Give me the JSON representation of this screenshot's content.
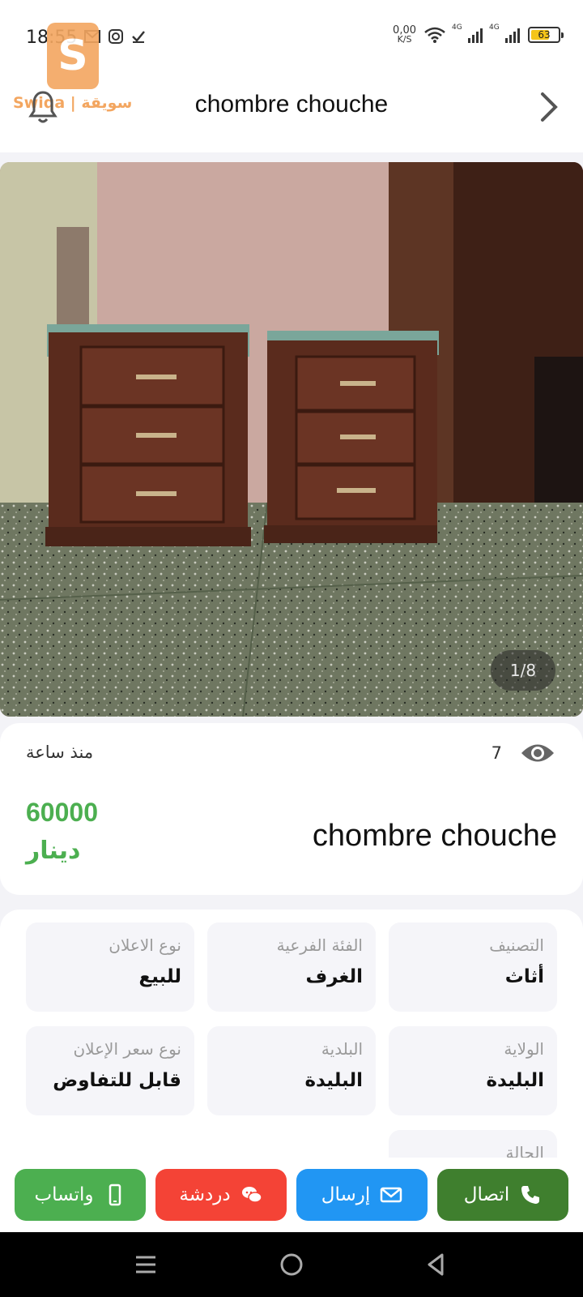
{
  "status_bar": {
    "time": "18:55",
    "net_speed_value": "0,00",
    "net_speed_unit": "K/S",
    "sim1": "4G",
    "sim2": "4G",
    "battery": "63"
  },
  "header": {
    "title": "chombre chouche",
    "logo_text": "Swiqa | سويقة"
  },
  "gallery": {
    "counter": "1/8"
  },
  "summary": {
    "posted": "منذ ساعة",
    "views": "7",
    "price": "60000",
    "currency": "دينار",
    "title": "chombre chouche"
  },
  "details": [
    {
      "label": "التصنيف",
      "value": "أثاث"
    },
    {
      "label": "الفئة الفرعية",
      "value": "الغرف"
    },
    {
      "label": "نوع الاعلان",
      "value": "للبيع"
    },
    {
      "label": "الولاية",
      "value": "البليدة"
    },
    {
      "label": "البلدية",
      "value": "البليدة"
    },
    {
      "label": "نوع سعر الإعلان",
      "value": "قابل للتفاوض"
    },
    {
      "label": "الحالة",
      "value": ""
    }
  ],
  "actions": {
    "whatsapp": "واتساب",
    "chat": "دردشة",
    "send": "إرسال",
    "call": "اتصال"
  },
  "colors": {
    "price_green": "#4caf50",
    "whatsapp": "#4caf50",
    "chat": "#f44336",
    "send": "#2196f3",
    "call": "#3f7f2e"
  }
}
